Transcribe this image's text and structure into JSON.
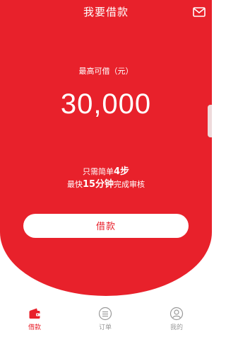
{
  "header": {
    "title": "我要借款",
    "mail_icon": "mail-icon"
  },
  "hero": {
    "max_label": "最高可借（元）",
    "max_amount": "30,000",
    "steps_prefix": "只需简单",
    "steps_count": "4步",
    "time_prefix": "最快",
    "time_value": "15分钟",
    "time_suffix": "完成审核",
    "button_label": "借款"
  },
  "tabs": [
    {
      "label": "借款",
      "icon": "wallet-icon",
      "active": true
    },
    {
      "label": "订单",
      "icon": "list-icon",
      "active": false
    },
    {
      "label": "我的",
      "icon": "person-icon",
      "active": false
    }
  ],
  "colors": {
    "accent": "#e8212b",
    "inactive": "#999999",
    "background": "#ffffff"
  }
}
